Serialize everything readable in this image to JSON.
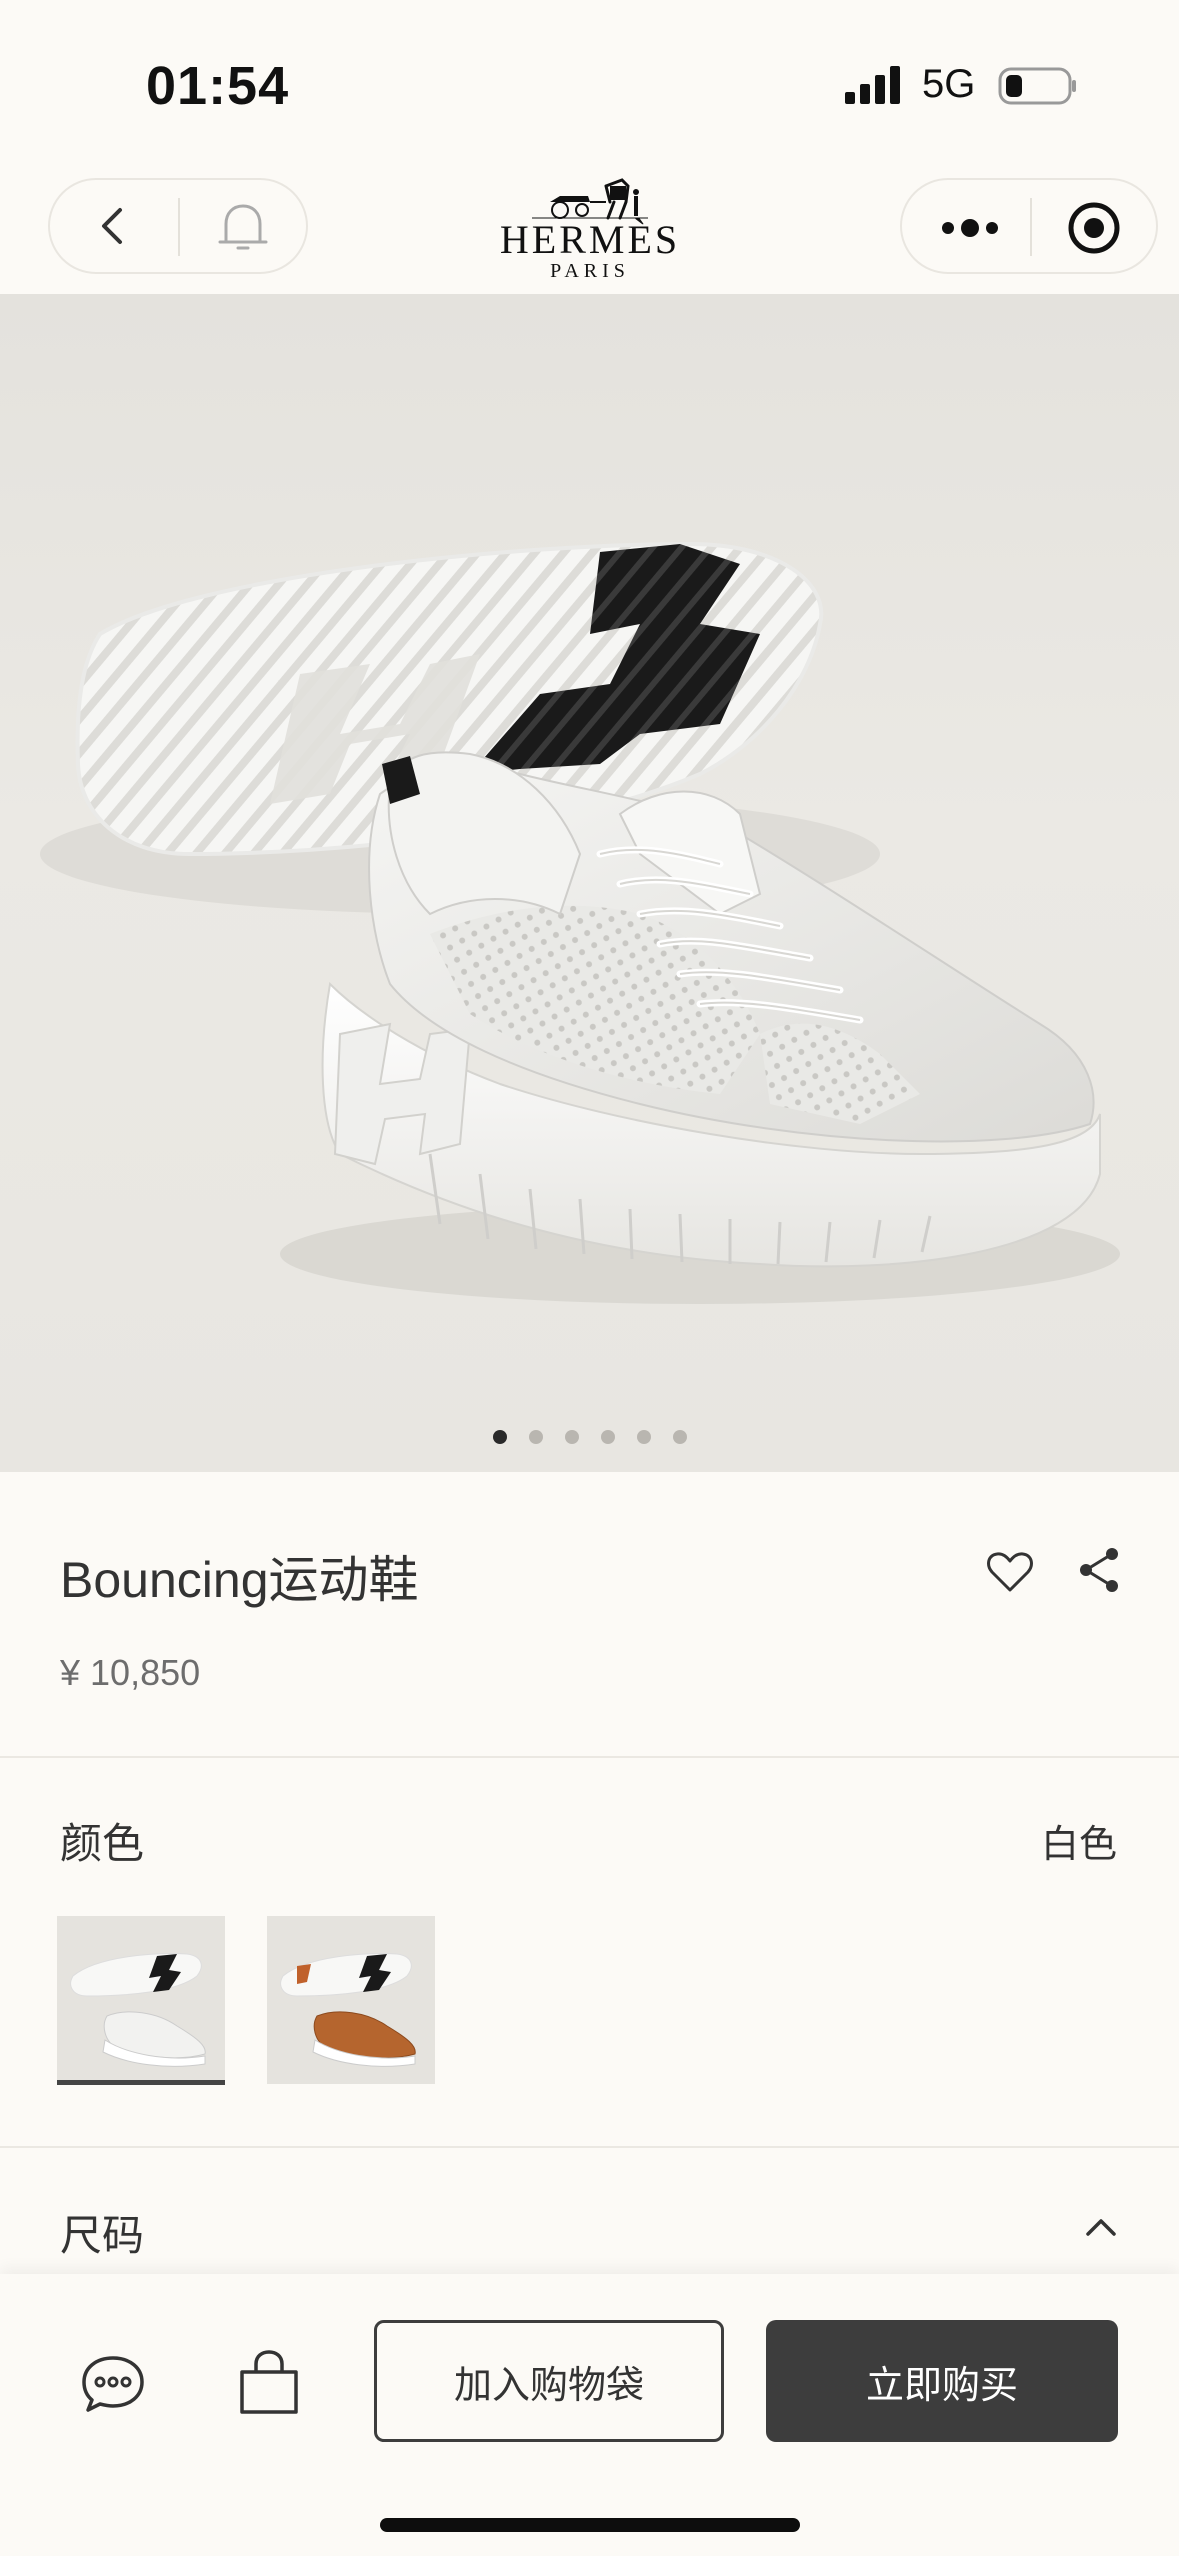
{
  "status_bar": {
    "time": "01:54",
    "network": "5G"
  },
  "nav": {
    "back_icon": "chevron-left-icon",
    "bell_icon": "bell-icon",
    "more_icon": "more-dots-icon",
    "target_icon": "target-icon"
  },
  "logo": {
    "brand": "HERMÈS",
    "city": "PARIS"
  },
  "gallery": {
    "image_count": 6,
    "active_index": 0
  },
  "product": {
    "title": "Bouncing运动鞋",
    "price": "¥ 10,850"
  },
  "color_section": {
    "label": "颜色",
    "selected": "白色",
    "swatches": [
      "white",
      "tan"
    ]
  },
  "size_section": {
    "label": "尺码"
  },
  "actions": {
    "add_to_bag": "加入购物袋",
    "buy_now": "立即购买"
  },
  "colors": {
    "background": "#fcfaf6",
    "primary_button": "#3d3d3d",
    "text": "#333333"
  }
}
